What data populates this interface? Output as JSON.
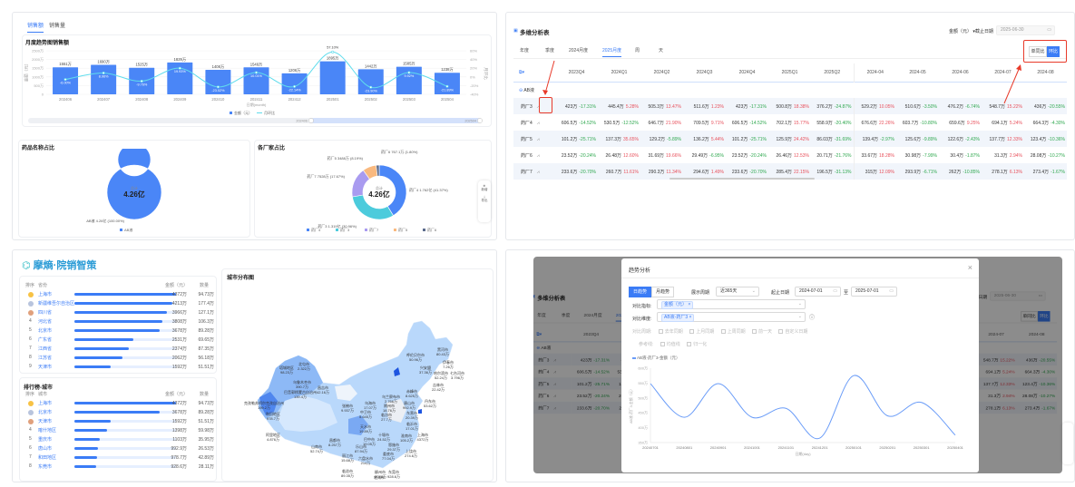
{
  "top_left": {
    "tabs": [
      "销售额",
      "销售量"
    ],
    "active_tab": 0,
    "card_title": "月度趋势图销售额",
    "y_left_label": "金额（元）",
    "y_right_label": "月环比",
    "slider_start": "202406",
    "slider_end": "202504",
    "pie1_title": "药品名称占比",
    "pie2_title": "各厂家占比",
    "side_tools": [
      "新增",
      "导出"
    ]
  },
  "table_panel": {
    "title": "多维分析表",
    "metric_select": "金额（元）",
    "cutoff_label": "截止日期",
    "cutoff_date": "2025-06-30",
    "tabs": [
      "年度",
      "季度",
      "2024月度",
      "2025月度",
      "周",
      "天"
    ],
    "active_tab": 3,
    "compare_buttons": [
      "单同比",
      "环比"
    ],
    "active_compare": 1,
    "columns": [
      "2023Q4",
      "2024Q1",
      "2024Q2",
      "2024Q3",
      "2024Q4",
      "2025Q1",
      "2025Q2",
      "2024-04",
      "2024-05",
      "2024-06",
      "2024-07",
      "2024-08"
    ],
    "group": "AB液",
    "rows": [
      {
        "name": "药厂3",
        "cells": [
          [
            "423万",
            "-17.31%"
          ],
          [
            "445.4万",
            "5.28%"
          ],
          [
            "505.3万",
            "13.47%"
          ],
          [
            "511.6万",
            "1.23%"
          ],
          [
            "423万",
            "-17.31%"
          ],
          [
            "500.8万",
            "18.38%"
          ],
          [
            "376.2万",
            "-24.87%"
          ],
          [
            "529.2万",
            "10.05%"
          ],
          [
            "510.6万",
            "-3.50%"
          ],
          [
            "476.2万",
            "-6.74%"
          ],
          [
            "548.7万",
            "15.22%"
          ],
          [
            "436万",
            "-20.55%"
          ]
        ]
      },
      {
        "name": "药厂4",
        "cells": [
          [
            "606.5万",
            "-14.52%"
          ],
          [
            "530.5万",
            "-12.52%"
          ],
          [
            "646.7万",
            "21.90%"
          ],
          [
            "709.5万",
            "9.71%"
          ],
          [
            "606.5万",
            "-14.52%"
          ],
          [
            "702.1万",
            "15.77%"
          ],
          [
            "558.9万",
            "-20.40%"
          ],
          [
            "676.6万",
            "22.26%"
          ],
          [
            "603.7万",
            "-10.80%"
          ],
          [
            "659.6万",
            "9.25%"
          ],
          [
            "694.1万",
            "5.24%"
          ],
          [
            "664.3万",
            "-4.30%"
          ]
        ]
      },
      {
        "name": "药厂5",
        "cells": [
          [
            "101.2万",
            "-25.71%"
          ],
          [
            "137.3万",
            "35.65%"
          ],
          [
            "129.2万",
            "-5.89%"
          ],
          [
            "136.2万",
            "5.44%"
          ],
          [
            "101.2万",
            "-25.71%"
          ],
          [
            "125.9万",
            "24.42%"
          ],
          [
            "86.03万",
            "-31.69%"
          ],
          [
            "139.4万",
            "-2.97%"
          ],
          [
            "125.6万",
            "-9.89%"
          ],
          [
            "122.6万",
            "-2.43%"
          ],
          [
            "137.7万",
            "12.33%"
          ],
          [
            "123.4万",
            "-10.36%"
          ]
        ]
      },
      {
        "name": "药厂6",
        "cells": [
          [
            "23.52万",
            "-20.24%"
          ],
          [
            "26.48万",
            "12.60%"
          ],
          [
            "31.69万",
            "19.66%"
          ],
          [
            "29.49万",
            "-6.95%"
          ],
          [
            "23.52万",
            "-20.24%"
          ],
          [
            "26.46万",
            "12.53%"
          ],
          [
            "20.71万",
            "-21.76%"
          ],
          [
            "33.67万",
            "18.28%"
          ],
          [
            "30.98万",
            "-7.99%"
          ],
          [
            "30.4万",
            "-1.87%"
          ],
          [
            "31.3万",
            "2.94%"
          ],
          [
            "28.08万",
            "-10.27%"
          ]
        ]
      },
      {
        "name": "药厂7",
        "cells": [
          [
            "233.6万",
            "-20.70%"
          ],
          [
            "260.7万",
            "11.61%"
          ],
          [
            "290.3万",
            "11.34%"
          ],
          [
            "294.6万",
            "1.49%"
          ],
          [
            "233.6万",
            "-20.70%"
          ],
          [
            "285.4万",
            "22.15%"
          ],
          [
            "196.5万",
            "-31.13%"
          ],
          [
            "315万",
            "12.09%"
          ],
          [
            "293.9万",
            "-6.71%"
          ],
          [
            "262万",
            "-10.85%"
          ],
          [
            "278.1万",
            "6.13%"
          ],
          [
            "273.4万",
            "-1.67%"
          ]
        ]
      }
    ],
    "colors": {
      "up": "#e8505b",
      "down": "#2fa84f",
      "accent": "#3b7cf6",
      "highlight": "#e83a2a"
    }
  },
  "bottom_left": {
    "logo_text": "摩熵·院销智策",
    "province_ranking": {
      "headers": [
        "排序",
        "省份",
        "金额（元）",
        "数量"
      ],
      "rows": [
        {
          "rank": "1",
          "name": "上海市",
          "amount": "4372万",
          "qty": "94.73万",
          "pct": 100
        },
        {
          "rank": "2",
          "name": "新疆维吾尔自治区",
          "amount": "4213万",
          "qty": "177.4万",
          "pct": 96
        },
        {
          "rank": "3",
          "name": "四川省",
          "amount": "3966万",
          "qty": "127.1万",
          "pct": 91
        },
        {
          "rank": "4",
          "name": "河北省",
          "amount": "3808万",
          "qty": "106.3万",
          "pct": 87
        },
        {
          "rank": "5",
          "name": "北京市",
          "amount": "3678万",
          "qty": "89.28万",
          "pct": 84
        },
        {
          "rank": "6",
          "name": "广东省",
          "amount": "2531万",
          "qty": "69.65万",
          "pct": 58
        },
        {
          "rank": "7",
          "name": "江西省",
          "amount": "2374万",
          "qty": "87.35万",
          "pct": 54
        },
        {
          "rank": "8",
          "name": "江苏省",
          "amount": "2062万",
          "qty": "56.18万",
          "pct": 47
        },
        {
          "rank": "9",
          "name": "天津市",
          "amount": "1592万",
          "qty": "51.51万",
          "pct": 36
        }
      ]
    },
    "city_ranking": {
      "title": "排行榜-城市",
      "headers": [
        "排序",
        "城市",
        "金额（元）",
        "数量"
      ],
      "rows": [
        {
          "rank": "1",
          "name": "上海市",
          "amount": "4372万",
          "qty": "94.73万",
          "pct": 100
        },
        {
          "rank": "2",
          "name": "北京市",
          "amount": "3678万",
          "qty": "89.28万",
          "pct": 84
        },
        {
          "rank": "3",
          "name": "天津市",
          "amount": "1592万",
          "qty": "51.51万",
          "pct": 36
        },
        {
          "rank": "4",
          "name": "喀什地区",
          "amount": "1398万",
          "qty": "59.98万",
          "pct": 32
        },
        {
          "rank": "5",
          "name": "重庆市",
          "amount": "1103万",
          "qty": "35.95万",
          "pct": 25
        },
        {
          "rank": "6",
          "name": "唐山市",
          "amount": "992.9万",
          "qty": "26.53万",
          "pct": 23
        },
        {
          "rank": "7",
          "name": "和田地区",
          "amount": "978.7万",
          "qty": "42.89万",
          "pct": 22
        },
        {
          "rank": "8",
          "name": "东莞市",
          "amount": "928.6万",
          "qty": "28.11万",
          "pct": 21
        }
      ]
    },
    "map_title": "城市分布图",
    "map_labels": [
      {
        "name": "北屯市",
        "value": "2.322万"
      },
      {
        "name": "塔城地区",
        "value": "98.23万"
      },
      {
        "name": "乌鲁木齐市",
        "value": "390.7万"
      },
      {
        "name": "昌吉市",
        "value": "42.16万"
      },
      {
        "name": "巴音郭楞蒙古自治州",
        "value": "139.4万"
      },
      {
        "name": "克孜勒苏柯尔克孜自治州",
        "value": "199.2万"
      },
      {
        "name": "和田地区",
        "value": "978.7万"
      },
      {
        "name": "阿里地区",
        "value": "4.876万"
      },
      {
        "name": "张掖市",
        "value": "9.937万"
      },
      {
        "name": "乌海市",
        "value": "17.07万"
      },
      {
        "name": "中卫市",
        "value": "5.645万"
      },
      {
        "name": "呼伦贝尔市",
        "value": "50.96万"
      },
      {
        "name": "黑河市",
        "value": "80.43万"
      },
      {
        "name": "伊春市",
        "value": "7.26万"
      },
      {
        "name": "兴安盟",
        "value": "37.36万"
      },
      {
        "name": "哈尔滨市",
        "value": "52.24万"
      },
      {
        "name": "七台河市",
        "value": "3.796万"
      },
      {
        "name": "吉林市",
        "value": "22.42万"
      },
      {
        "name": "赤峰市",
        "value": "8.625万"
      },
      {
        "name": "乌兰察布市",
        "value": "2.766万"
      },
      {
        "name": "唐山市",
        "value": "992.9万"
      },
      {
        "name": "丹东市",
        "value": "53.62万"
      },
      {
        "name": "朔州市",
        "value": "18.76万"
      },
      {
        "name": "东营市",
        "value": "20.39万"
      },
      {
        "name": "临汾市",
        "value": "27.7万"
      },
      {
        "name": "临沂市",
        "value": "17.01万"
      },
      {
        "name": "天水市",
        "value": "19.89万"
      },
      {
        "name": "十堰市",
        "value": "24.52万"
      },
      {
        "name": "淮南市",
        "value": "105.2万"
      },
      {
        "name": "巴中市",
        "value": "19.05万"
      },
      {
        "name": "上海市",
        "value": "4372万"
      },
      {
        "name": "昌都市",
        "value": "8.257万"
      },
      {
        "name": "山南市",
        "value": "52.74万"
      },
      {
        "name": "乐山市",
        "value": "87.94万"
      },
      {
        "name": "恩施市",
        "value": "29.37万"
      },
      {
        "name": "上饶市",
        "value": "274.6万"
      },
      {
        "name": "娄底市",
        "value": "77.04万"
      },
      {
        "name": "丽江市",
        "value": "15.68万"
      },
      {
        "name": "六盘水市",
        "value": "214万"
      },
      {
        "name": "临沧市",
        "value": "89.35万"
      },
      {
        "name": "柳州市",
        "value": "48.76万"
      },
      {
        "name": "东莞市",
        "value": "928.6万"
      },
      {
        "name": "北海市",
        "value": ""
      }
    ]
  },
  "modal": {
    "title": "趋势分析",
    "trend_buttons": [
      "日趋势",
      "月趋势"
    ],
    "active_trend": 0,
    "period_label": "展示周期",
    "period_value": "近365天",
    "date_label": "起止日期",
    "date_start": "2024-07-01",
    "date_sep": "至",
    "date_end": "2025-07-01",
    "metric_label": "对比指标:",
    "metric_tag": "金额（元）",
    "dimension_label": "对比维度:",
    "dimension_tag": "AB液-药厂3",
    "period_compare_label": "对比周期:",
    "period_compare_options": [
      "去年同期",
      "上月同期",
      "上周同期",
      "前一天",
      "自定义日期"
    ],
    "refline_label": "参考线:",
    "refline_options": [
      "均值线",
      "归一化"
    ]
  },
  "chart_data": [
    {
      "type": "bar",
      "title": "月度趋势图销售额",
      "categories": [
        "202406",
        "202407",
        "202408",
        "202409",
        "202410",
        "202411",
        "202412",
        "202501",
        "202502",
        "202503",
        "202504"
      ],
      "series": [
        {
          "name": "金额（元）",
          "type": "bar",
          "values": [
            1551,
            1690,
            1525,
            1829,
            1408,
            1549,
            1206,
            1895,
            1442,
            1585,
            1238
          ],
          "unit": "万",
          "labels": [
            "1551万",
            "1690万",
            "1525万",
            "1829万",
            "1408万",
            "1549万",
            "1206万",
            "1895万",
            "1442万",
            "1585万",
            "1238万"
          ]
        },
        {
          "name": "月环比",
          "type": "line",
          "values": [
            -6.0,
            8.96,
            -9.76,
            19.93,
            -23.02,
            10.01,
            -22.14,
            57.1,
            -23.9,
            9.92,
            -21.89
          ],
          "unit": "%",
          "labels": [
            "-6.00%",
            "8.96%",
            "-9.76%",
            "19.93%",
            "-23.02%",
            "10.01%",
            "-22.14%",
            "57.10%",
            "-23.90%",
            "9.92%",
            "-21.89%"
          ]
        }
      ],
      "xlabel": "日期(month)",
      "ylabel": "金额（元）",
      "y2label": "月环比",
      "ylim": [
        0,
        2500
      ],
      "yticks": [
        "0",
        "500万",
        "1000万",
        "1500万",
        "2000万",
        "2500万"
      ],
      "y2lim": [
        -40,
        60
      ],
      "y2ticks": [
        "-40%",
        "-20%",
        "0%",
        "20%",
        "40%",
        "60%"
      ],
      "colors": {
        "bar": "#4a86f7",
        "line": "#5fdcec"
      },
      "legend": "bottom"
    },
    {
      "type": "pie",
      "title": "药品名称占比",
      "center_label": "总计",
      "center_value": "4.26亿",
      "slices": [
        {
          "name": "AB液",
          "value": 100.0,
          "label": "AB液 4.26亿 (100.00%)",
          "color": "#4a86f7"
        }
      ],
      "legend": "bottom"
    },
    {
      "type": "pie",
      "title": "各厂家占比",
      "center_label": "总计",
      "center_value": "4.26亿",
      "slices": [
        {
          "name": "药厂4",
          "value": 41.37,
          "label": "药厂4 1.762亿 (41.37%)",
          "color": "#4a86f7"
        },
        {
          "name": "药厂3",
          "value": 30.96,
          "label": "药厂3 1.319亿 (30.96%)",
          "color": "#4ccbdc"
        },
        {
          "name": "药厂7",
          "value": 17.67,
          "label": "药厂7 7528万 (17.67%)",
          "color": "#a99bf0"
        },
        {
          "name": "药厂5",
          "value": 8.19,
          "label": "药厂5 3488万 (8.19%)",
          "color": "#f9b97f"
        },
        {
          "name": "药厂6",
          "value": 1.8,
          "label": "药厂6 767.1万 (1.80%)",
          "color": "#5b6b8c"
        }
      ],
      "legend": "bottom"
    },
    {
      "type": "line",
      "title": "AB液-药厂3-金额（元）",
      "x": [
        "20240701",
        "20240801",
        "20240901",
        "20241001",
        "20241101",
        "20241201",
        "20250101",
        "20250201",
        "20250301",
        "20250401"
      ],
      "series": [
        {
          "name": "AB液-药厂3-金额（元）",
          "values": [
            548,
            435,
            548,
            435,
            465,
            365,
            575,
            440,
            485,
            375
          ],
          "unit": "万"
        }
      ],
      "xlabel": "日期(day)",
      "ylabel": "AB液-药厂3-金额（元）",
      "ylim": [
        350,
        600
      ],
      "yticks": [
        "350万",
        "400万",
        "450万",
        "500万",
        "550万",
        "600万"
      ],
      "color": "#6a9cf8",
      "legend": "top-left"
    }
  ]
}
